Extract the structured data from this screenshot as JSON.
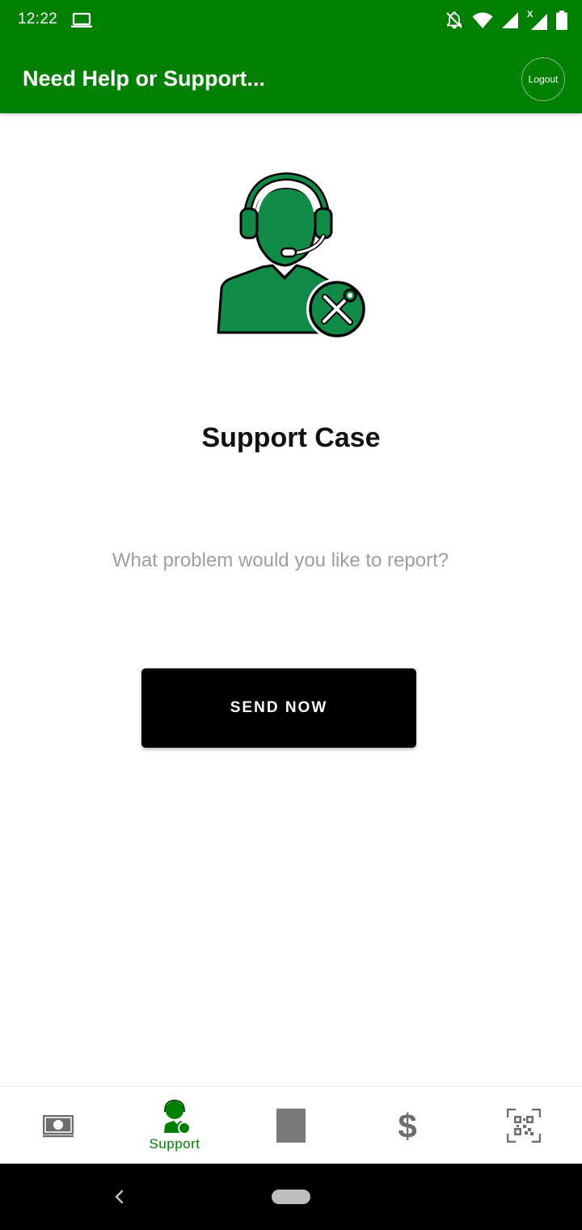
{
  "status_bar": {
    "time": "12:22",
    "icons": [
      "laptop-icon",
      "notifications-off-icon",
      "wifi-icon",
      "signal-icon",
      "signal-x-icon",
      "battery-icon"
    ]
  },
  "app_bar": {
    "title": "Need Help or Support...",
    "logout_label": "Logout"
  },
  "main": {
    "hero_icon": "customer-support-tools-icon",
    "title": "Support Case",
    "problem_placeholder": "What problem would you like to report?",
    "problem_value": "",
    "send_label": "SEND NOW"
  },
  "bottom_nav": {
    "items": [
      {
        "icon": "cash-icon",
        "label": "",
        "active": false
      },
      {
        "icon": "support-agent-icon",
        "label": "Support",
        "active": true
      },
      {
        "icon": "square-icon",
        "label": "",
        "active": false
      },
      {
        "icon": "dollar-icon",
        "label": "",
        "active": false
      },
      {
        "icon": "qr-scan-icon",
        "label": "",
        "active": false
      }
    ]
  },
  "colors": {
    "primary": "#008000",
    "hero_fill": "#0f8a47",
    "button_bg": "#000000",
    "inactive_icon": "#757575"
  }
}
